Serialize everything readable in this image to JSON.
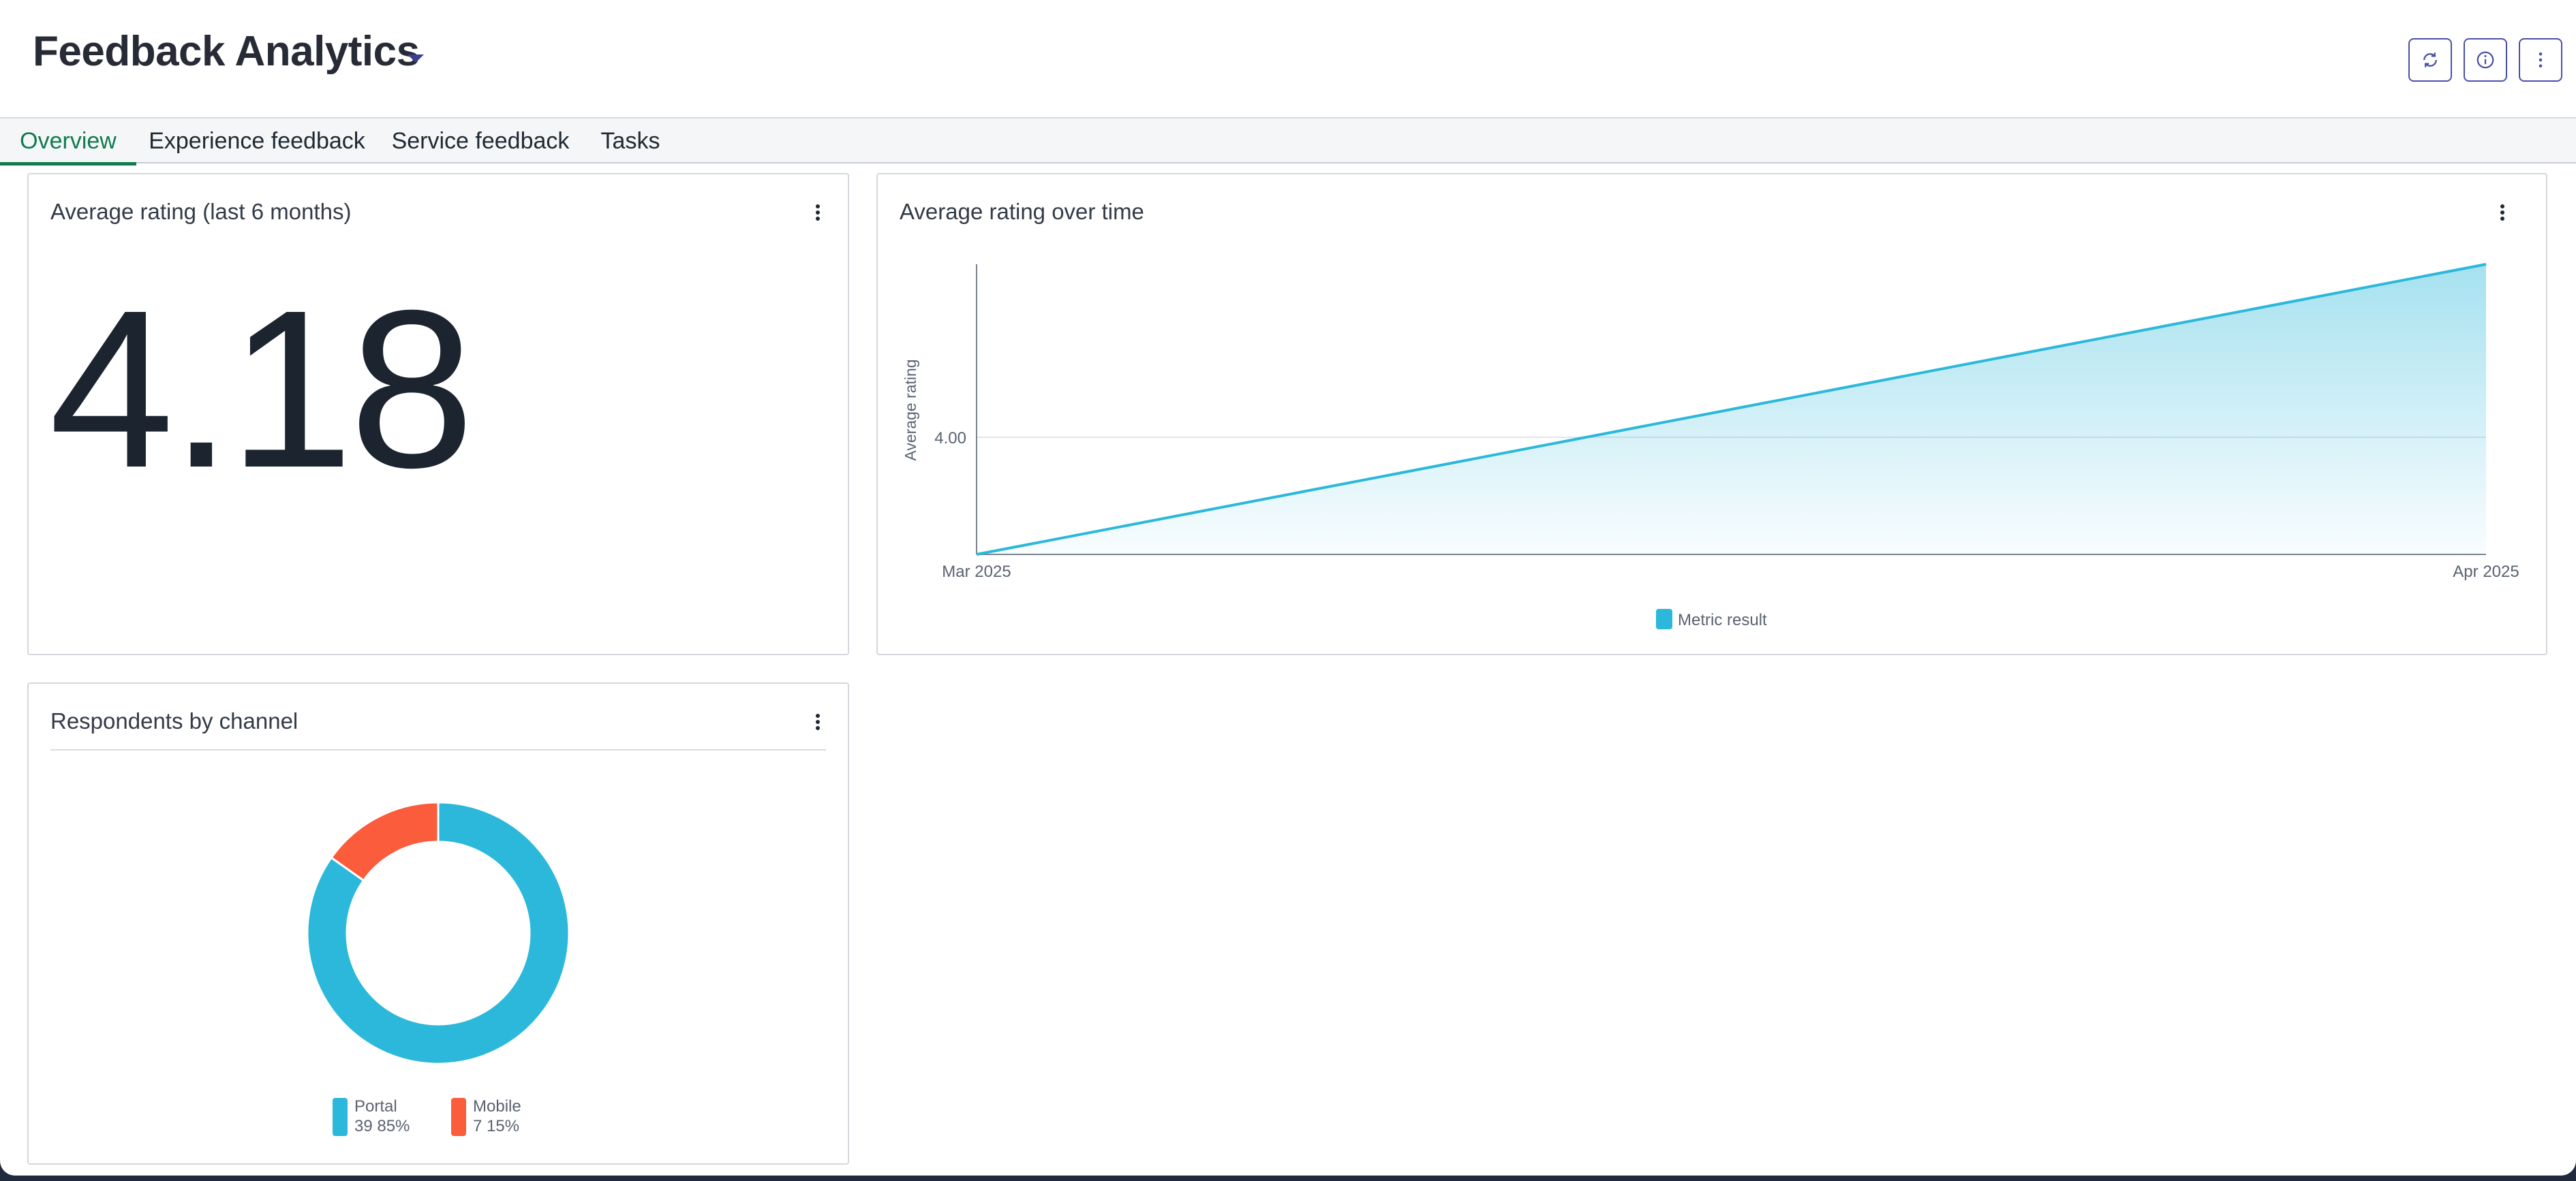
{
  "header": {
    "title": "Feedback Analytics",
    "buttons": [
      {
        "name": "refresh",
        "icon": "refresh-icon"
      },
      {
        "name": "info",
        "icon": "info-icon"
      },
      {
        "name": "more",
        "icon": "more-vertical-icon"
      }
    ],
    "accent_color": "#4a4fa8"
  },
  "tabs": [
    {
      "label": "Overview",
      "active": true
    },
    {
      "label": "Experience feedback",
      "active": false
    },
    {
      "label": "Service feedback",
      "active": false
    },
    {
      "label": "Tasks",
      "active": false
    }
  ],
  "cards": {
    "avg_rating": {
      "title": "Average rating (last 6 months)",
      "value": "4.18"
    },
    "rating_over_time": {
      "title": "Average rating over time"
    },
    "respondents": {
      "title": "Respondents by channel"
    }
  },
  "chart_data": [
    {
      "type": "area",
      "title": "Average rating over time",
      "ylabel": "Average rating",
      "xlabel": "",
      "x": [
        "Mar 2025",
        "Apr 2025"
      ],
      "series": [
        {
          "name": "Metric result",
          "values": [
            3.2,
            4.74
          ],
          "color": "#2bb8da"
        }
      ],
      "y_ticks": [
        "4.00"
      ],
      "ylim": [
        3.2,
        4.74
      ],
      "grid": true,
      "legend": "bottom-center"
    },
    {
      "type": "pie",
      "title": "Respondents by channel",
      "donut": true,
      "slices": [
        {
          "name": "Portal",
          "value": 39,
          "percent": "85%",
          "label": "39 85%",
          "color": "#2bb8da"
        },
        {
          "name": "Mobile",
          "value": 7,
          "percent": "15%",
          "label": "7 15%",
          "color": "#fa5c3c"
        }
      ],
      "legend": "bottom"
    }
  ]
}
